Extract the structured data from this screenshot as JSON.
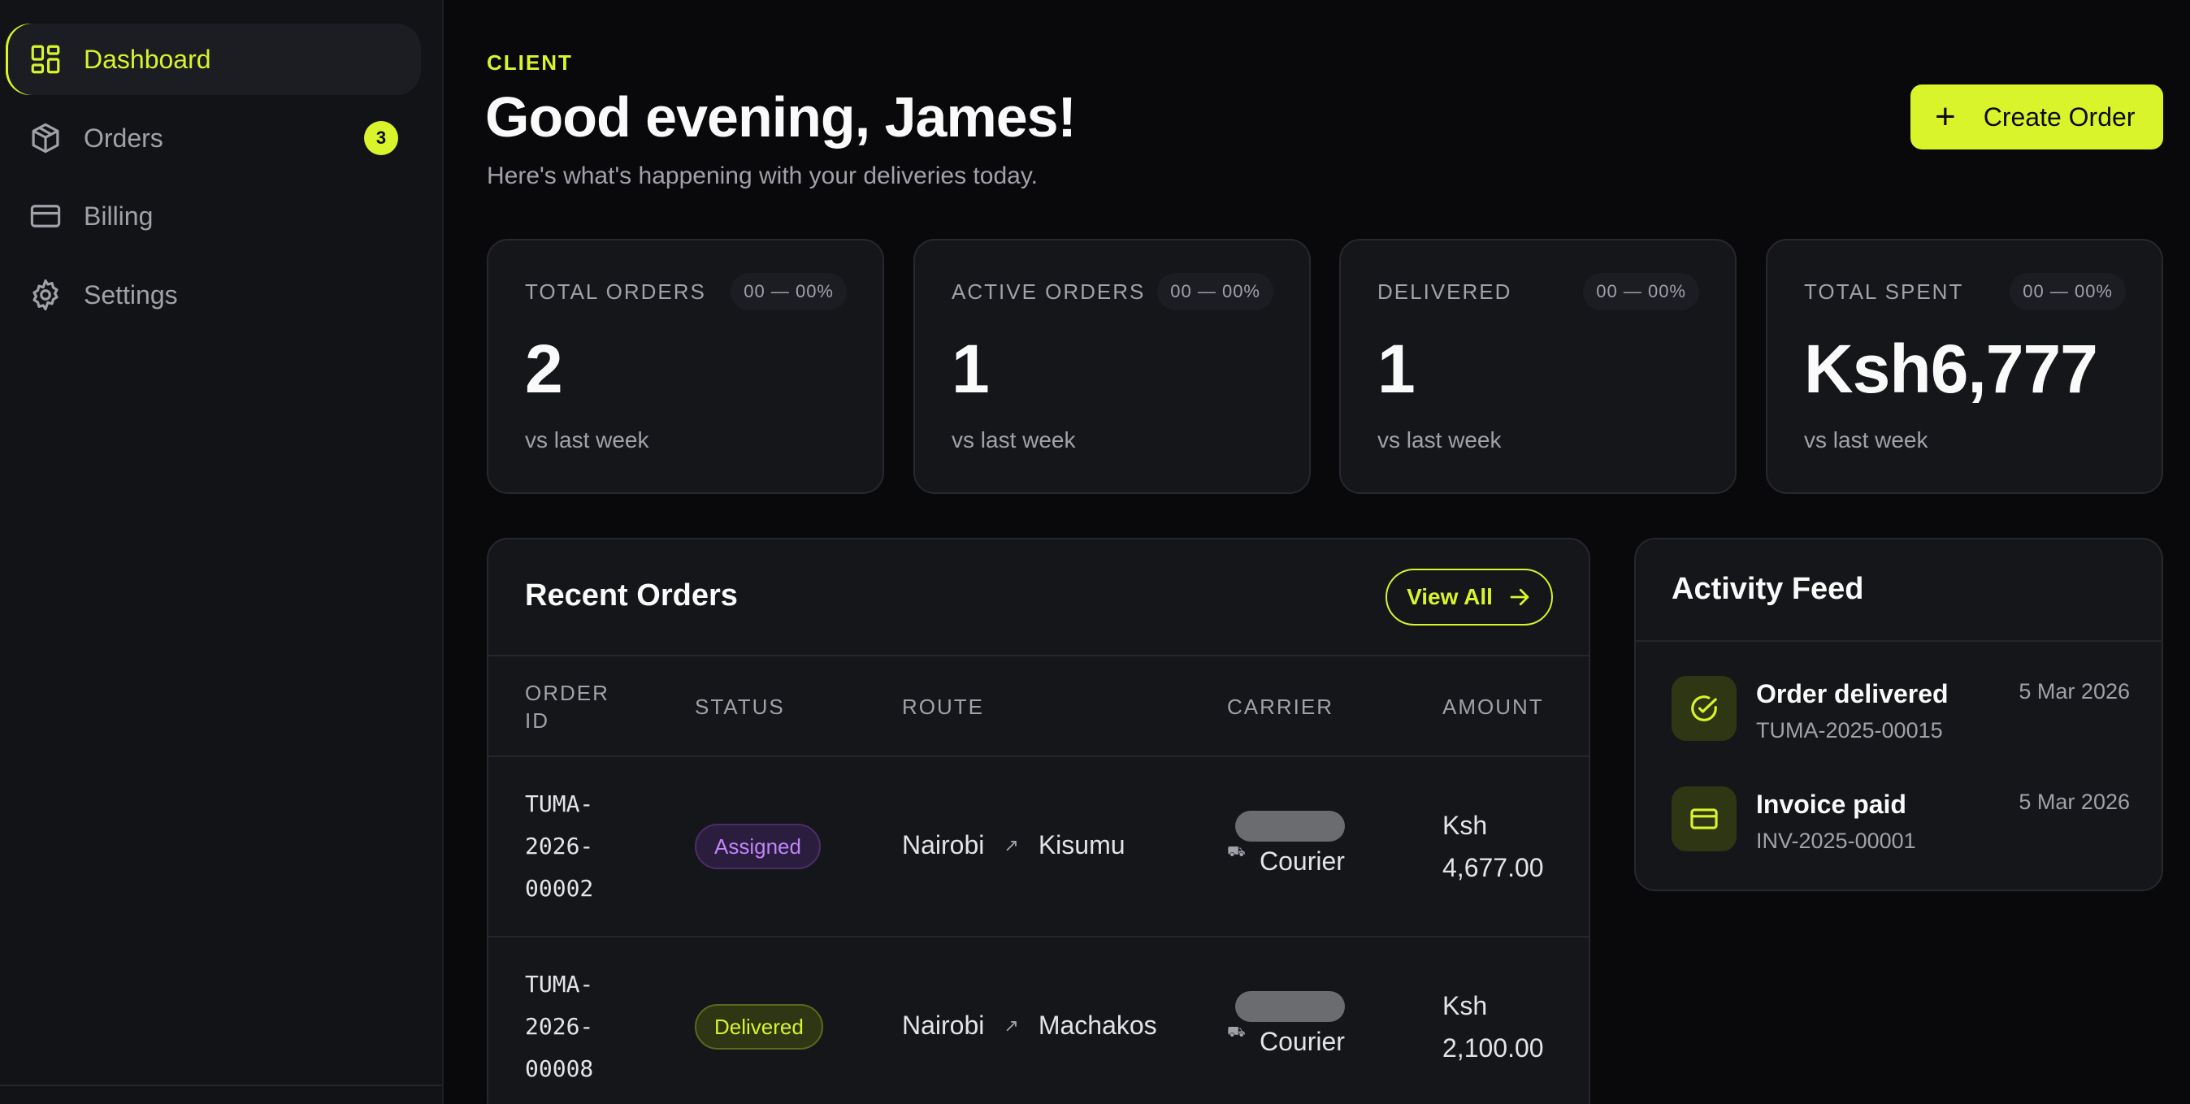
{
  "sidebar": {
    "items": [
      {
        "label": "Dashboard",
        "icon": "dashboard-icon",
        "active": true
      },
      {
        "label": "Orders",
        "icon": "package-icon",
        "badge": "3"
      },
      {
        "label": "Billing",
        "icon": "credit-card-icon"
      },
      {
        "label": "Settings",
        "icon": "gear-icon"
      }
    ]
  },
  "header": {
    "eyebrow": "CLIENT",
    "greeting": "Good evening, James!",
    "subtitle": "Here's what's happening with your deliveries today.",
    "create_button": "Create Order"
  },
  "stats": [
    {
      "label": "TOTAL ORDERS",
      "pill": "00 — 00%",
      "value": "2",
      "foot": "vs last week"
    },
    {
      "label": "ACTIVE ORDERS",
      "pill": "00 — 00%",
      "value": "1",
      "foot": "vs last week"
    },
    {
      "label": "DELIVERED",
      "pill": "00 — 00%",
      "value": "1",
      "foot": "vs last week"
    },
    {
      "label": "TOTAL SPENT",
      "pill": "00 — 00%",
      "value": "Ksh6,777",
      "foot": "vs last week"
    }
  ],
  "recent_orders": {
    "title": "Recent Orders",
    "view_all": "View All",
    "columns": [
      "ORDER ID",
      "STATUS",
      "ROUTE",
      "CARRIER",
      "AMOUNT"
    ],
    "rows": [
      {
        "id_lines": [
          "TUMA-",
          "2026-",
          "00002"
        ],
        "status": "Assigned",
        "from": "Nairobi",
        "to": "Kisumu",
        "carrier": "Courier",
        "amount_lines": [
          "Ksh",
          "4,677.00"
        ]
      },
      {
        "id_lines": [
          "TUMA-",
          "2026-",
          "00008"
        ],
        "status": "Delivered",
        "from": "Nairobi",
        "to": "Machakos",
        "carrier": "Courier",
        "amount_lines": [
          "Ksh",
          "2,100.00"
        ]
      }
    ]
  },
  "activity": {
    "title": "Activity Feed",
    "items": [
      {
        "title": "Order delivered",
        "sub": "TUMA-2025-00015",
        "date": "5 Mar 2026",
        "icon": "check-circle-icon"
      },
      {
        "title": "Invoice paid",
        "sub": "INV-2025-00001",
        "date": "5 Mar 2026",
        "icon": "credit-card-icon"
      }
    ]
  },
  "colors": {
    "accent": "#d9f42b",
    "background": "#09090b",
    "panel": "#15161a",
    "assigned": "#c084fc"
  }
}
